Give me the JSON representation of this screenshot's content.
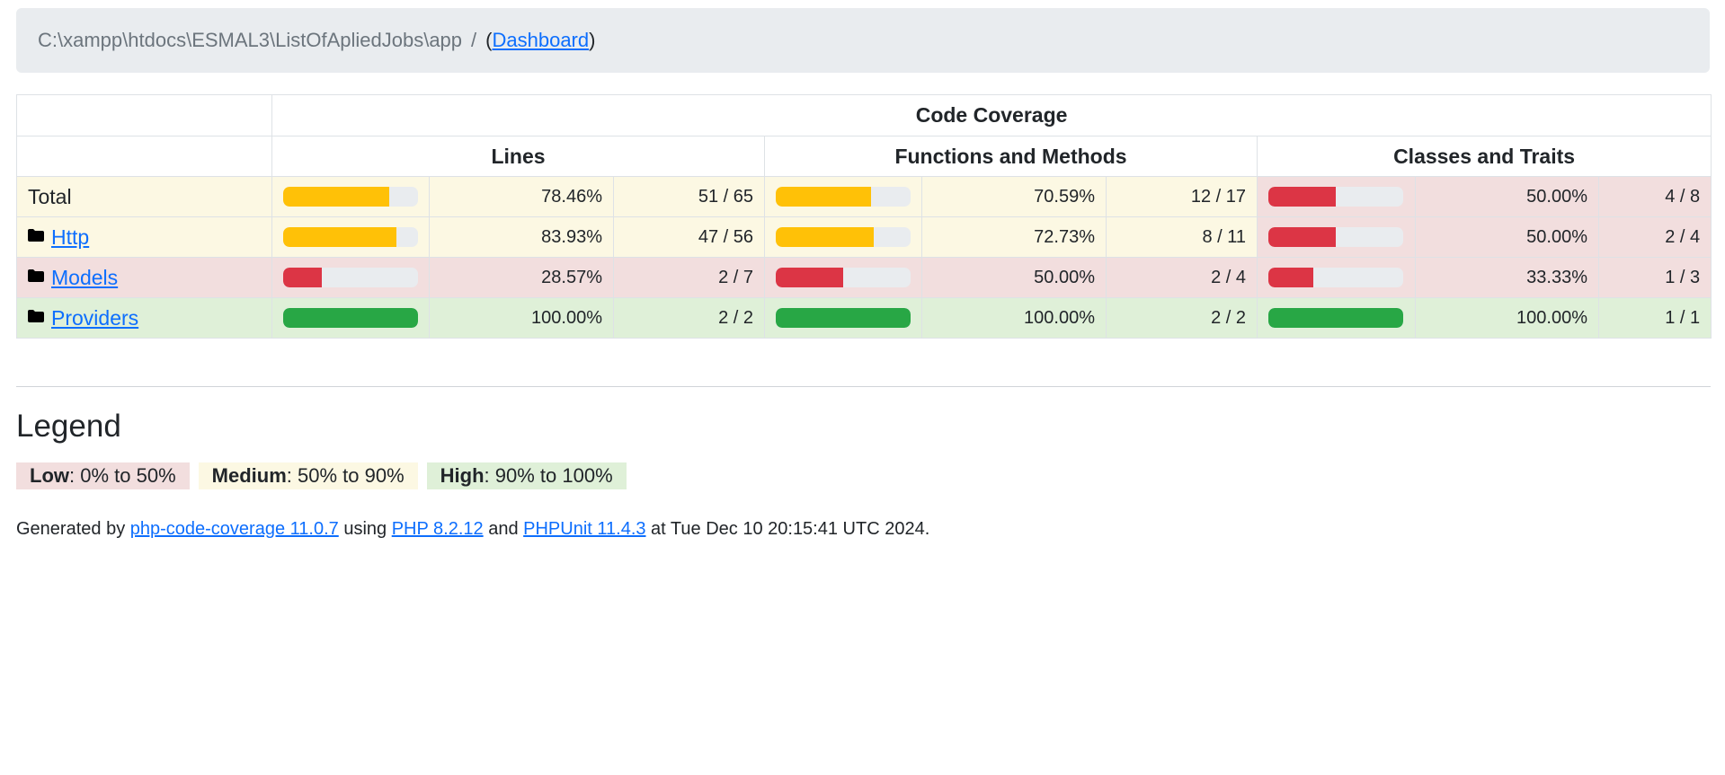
{
  "breadcrumb": {
    "path": "C:\\xampp\\htdocs\\ESMAL3\\ListOfApliedJobs\\app",
    "separator": "/",
    "open_paren": "(",
    "dashboard_link": "Dashboard",
    "close_paren": ")"
  },
  "table": {
    "caption": "Code Coverage",
    "groups": {
      "lines": "Lines",
      "functions": "Functions and Methods",
      "classes": "Classes and Traits"
    },
    "rows": [
      {
        "name": "Total",
        "is_link": false,
        "lines": {
          "pct": "78.46%",
          "count": "51 / 65",
          "fill": 0.7846,
          "level": "warning"
        },
        "functions": {
          "pct": "70.59%",
          "count": "12 / 17",
          "fill": 0.7059,
          "level": "warning"
        },
        "classes": {
          "pct": "50.00%",
          "count": "4 / 8",
          "fill": 0.5,
          "level": "danger"
        }
      },
      {
        "name": "Http",
        "is_link": true,
        "lines": {
          "pct": "83.93%",
          "count": "47 / 56",
          "fill": 0.8393,
          "level": "warning"
        },
        "functions": {
          "pct": "72.73%",
          "count": "8 / 11",
          "fill": 0.7273,
          "level": "warning"
        },
        "classes": {
          "pct": "50.00%",
          "count": "2 / 4",
          "fill": 0.5,
          "level": "danger"
        }
      },
      {
        "name": "Models",
        "is_link": true,
        "lines": {
          "pct": "28.57%",
          "count": "2 / 7",
          "fill": 0.2857,
          "level": "danger"
        },
        "functions": {
          "pct": "50.00%",
          "count": "2 / 4",
          "fill": 0.5,
          "level": "danger"
        },
        "classes": {
          "pct": "33.33%",
          "count": "1 / 3",
          "fill": 0.3333,
          "level": "danger"
        }
      },
      {
        "name": "Providers",
        "is_link": true,
        "lines": {
          "pct": "100.00%",
          "count": "2 / 2",
          "fill": 1.0,
          "level": "success"
        },
        "functions": {
          "pct": "100.00%",
          "count": "2 / 2",
          "fill": 1.0,
          "level": "success"
        },
        "classes": {
          "pct": "100.00%",
          "count": "1 / 1",
          "fill": 1.0,
          "level": "success"
        }
      }
    ]
  },
  "colors": {
    "warning_bar": "#ffc107",
    "danger_bar": "#dc3545",
    "success_bar": "#28a745",
    "warning_bg": "#fcf8e3",
    "danger_bg": "#f2dede",
    "success_bg": "#dff0d8",
    "link": "#0d6efd"
  },
  "legend": {
    "title": "Legend",
    "low_label": "Low",
    "low_range": ": 0% to 50%",
    "medium_label": "Medium",
    "medium_range": ": 50% to 90%",
    "high_label": "High",
    "high_range": ": 90% to 100%"
  },
  "footer": {
    "generated_by": "Generated by ",
    "coverage_link": "php-code-coverage 11.0.7",
    "using": " using ",
    "php_link": "PHP 8.2.12",
    "and": " and ",
    "phpunit_link": "PHPUnit 11.4.3",
    "at": " at Tue Dec 10 20:15:41 UTC 2024."
  },
  "icons": {
    "folder": "folder-icon"
  }
}
